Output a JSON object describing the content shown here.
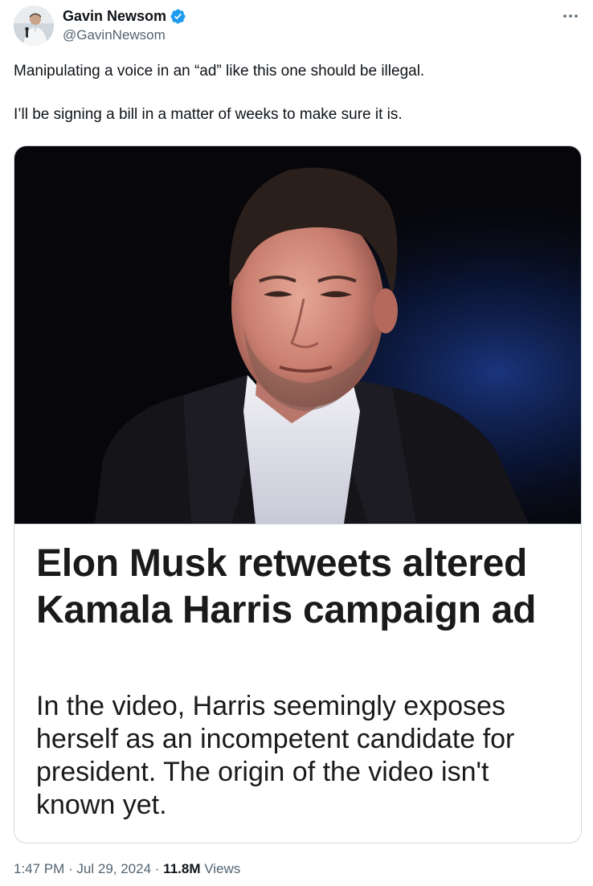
{
  "author": {
    "display_name": "Gavin Newsom",
    "handle": "@GavinNewsom",
    "verified": true,
    "verified_color": "#1d9bf0"
  },
  "tweet": {
    "line1": "Manipulating a voice in an “ad” like this one should be illegal.",
    "line2": "I’ll be signing a bill in a matter of weeks to make sure it is."
  },
  "card": {
    "headline": "Elon Musk retweets altered Kamala Harris campaign ad",
    "summary": "In the video, Harris seemingly exposes herself as an incompetent candidate for president. The origin of the video isn't known yet."
  },
  "meta": {
    "time": "1:47 PM",
    "separator": " · ",
    "date": "Jul 29, 2024",
    "views_count": "11.8M",
    "views_label": " Views"
  },
  "icons": {
    "more": "more-horizontal-icon",
    "verified": "verified-badge-icon"
  }
}
